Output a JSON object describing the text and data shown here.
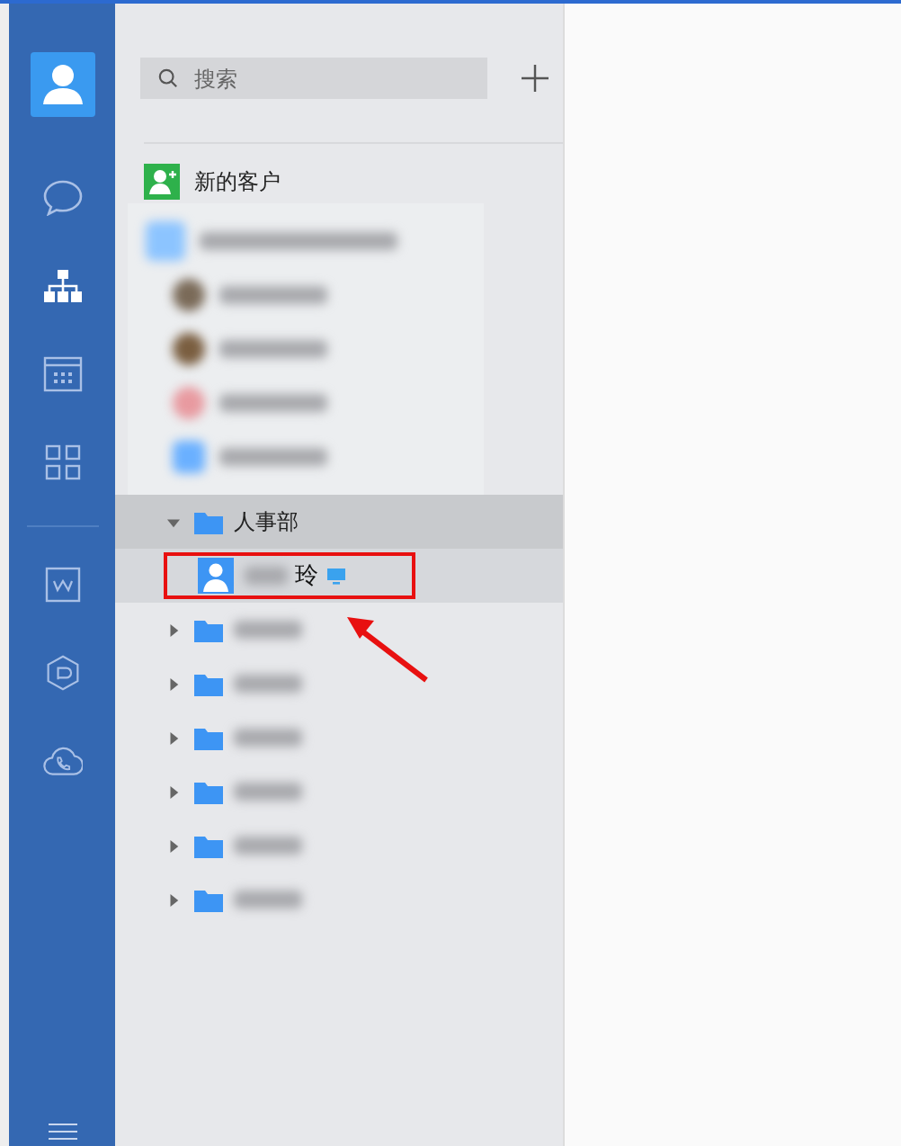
{
  "nav": {
    "primary": [
      {
        "kind": "chat",
        "selected": false
      },
      {
        "kind": "contacts",
        "selected": true
      },
      {
        "kind": "calendar",
        "selected": false
      },
      {
        "kind": "apps",
        "selected": false
      }
    ],
    "secondary": [
      {
        "kind": "docs",
        "selected": false
      },
      {
        "kind": "drive",
        "selected": false
      },
      {
        "kind": "meeting",
        "selected": false
      }
    ]
  },
  "search": {
    "placeholder": "搜索"
  },
  "new_customers": {
    "label": "新的客户"
  },
  "tree": [
    {
      "kind": "company",
      "expanded": true,
      "children": [
        {
          "kind": "member"
        },
        {
          "kind": "member"
        },
        {
          "kind": "member"
        },
        {
          "kind": "subgroup"
        }
      ]
    },
    {
      "kind": "department",
      "name": "人事部",
      "expanded": true,
      "children": [
        {
          "kind": "member",
          "name": "玲",
          "online": true,
          "selected": true
        }
      ]
    },
    {
      "kind": "department",
      "expanded": false
    },
    {
      "kind": "department",
      "expanded": false
    },
    {
      "kind": "department",
      "expanded": false
    },
    {
      "kind": "department",
      "expanded": false
    },
    {
      "kind": "department",
      "expanded": false
    },
    {
      "kind": "department",
      "expanded": false
    }
  ],
  "annotation": {
    "highlight": true,
    "arrow": true
  }
}
